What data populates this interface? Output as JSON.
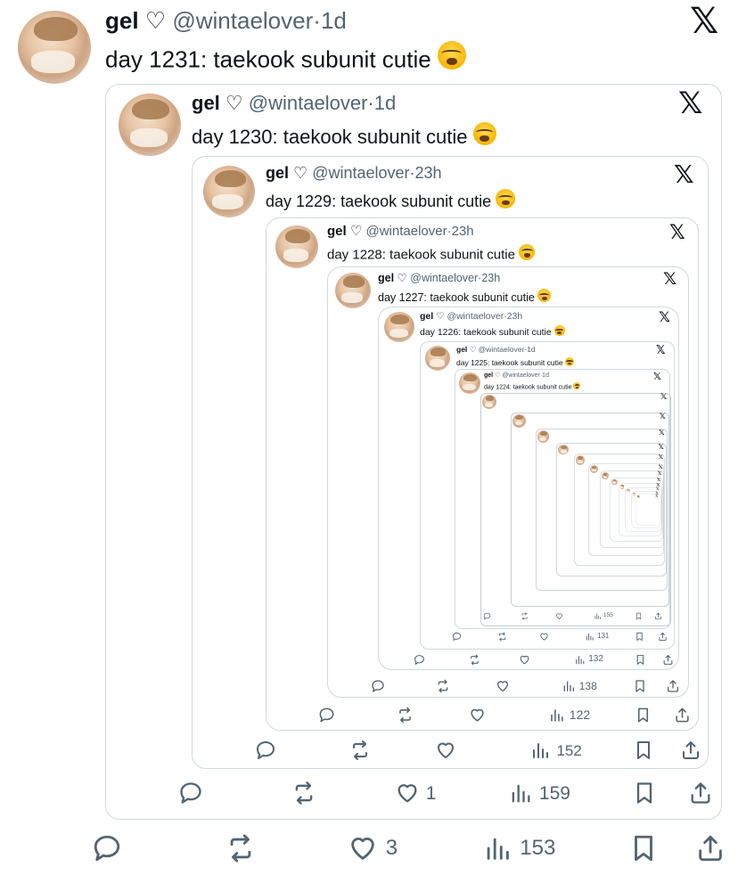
{
  "tweets": [
    {
      "name": "gel",
      "heart": "♡",
      "handle": "@wintaelover",
      "dot": "·",
      "time": "1d",
      "text": "day 1231: taekook subunit cutie",
      "stats": {
        "views": "153",
        "likes": "3",
        "replies": "",
        "reposts": ""
      }
    },
    {
      "name": "gel",
      "heart": "♡",
      "handle": "@wintaelover",
      "dot": "·",
      "time": "1d",
      "text": "day 1230: taekook subunit cutie",
      "stats": {
        "views": "159",
        "likes": "1"
      }
    },
    {
      "name": "gel",
      "heart": "♡",
      "handle": "@wintaelover",
      "dot": "·",
      "time": "23h",
      "text": "day 1229: taekook subunit cutie",
      "stats": {
        "views": "152"
      }
    },
    {
      "name": "gel",
      "heart": "♡",
      "handle": "@wintaelover",
      "dot": "·",
      "time": "23h",
      "text": "day 1228: taekook subunit cutie",
      "stats": {
        "views": "122"
      }
    },
    {
      "name": "gel",
      "heart": "♡",
      "handle": "@wintaelover",
      "dot": "·",
      "time": "23h",
      "text": "day 1227: taekook subunit cutie",
      "stats": {
        "views": "138"
      }
    },
    {
      "name": "gel",
      "heart": "♡",
      "handle": "@wintaelover",
      "dot": "·",
      "time": "23h",
      "text": "day 1226: taekook subunit cutie",
      "stats": {
        "views": "132"
      }
    },
    {
      "name": "gel",
      "heart": "♡",
      "handle": "@wintaelover",
      "dot": "·",
      "time": "1d",
      "text": "day 1225: taekook subunit cutie",
      "stats": {
        "views": "131"
      }
    },
    {
      "name": "gel",
      "heart": "♡",
      "handle": "@wintaelover",
      "dot": "·",
      "time": "1d",
      "text": "day 1224: taekook subunit cutie",
      "stats": {
        "views": "155"
      }
    }
  ],
  "brand": {
    "x_logo": "𝕏"
  },
  "icons": {
    "reply": "reply-icon",
    "repost": "repost-icon",
    "like": "heart-icon",
    "views": "views-icon",
    "bookmark": "bookmark-icon",
    "share": "share-icon"
  },
  "colors": {
    "text": "#0f1419",
    "secondary": "#536471",
    "border": "#cfd9de"
  }
}
